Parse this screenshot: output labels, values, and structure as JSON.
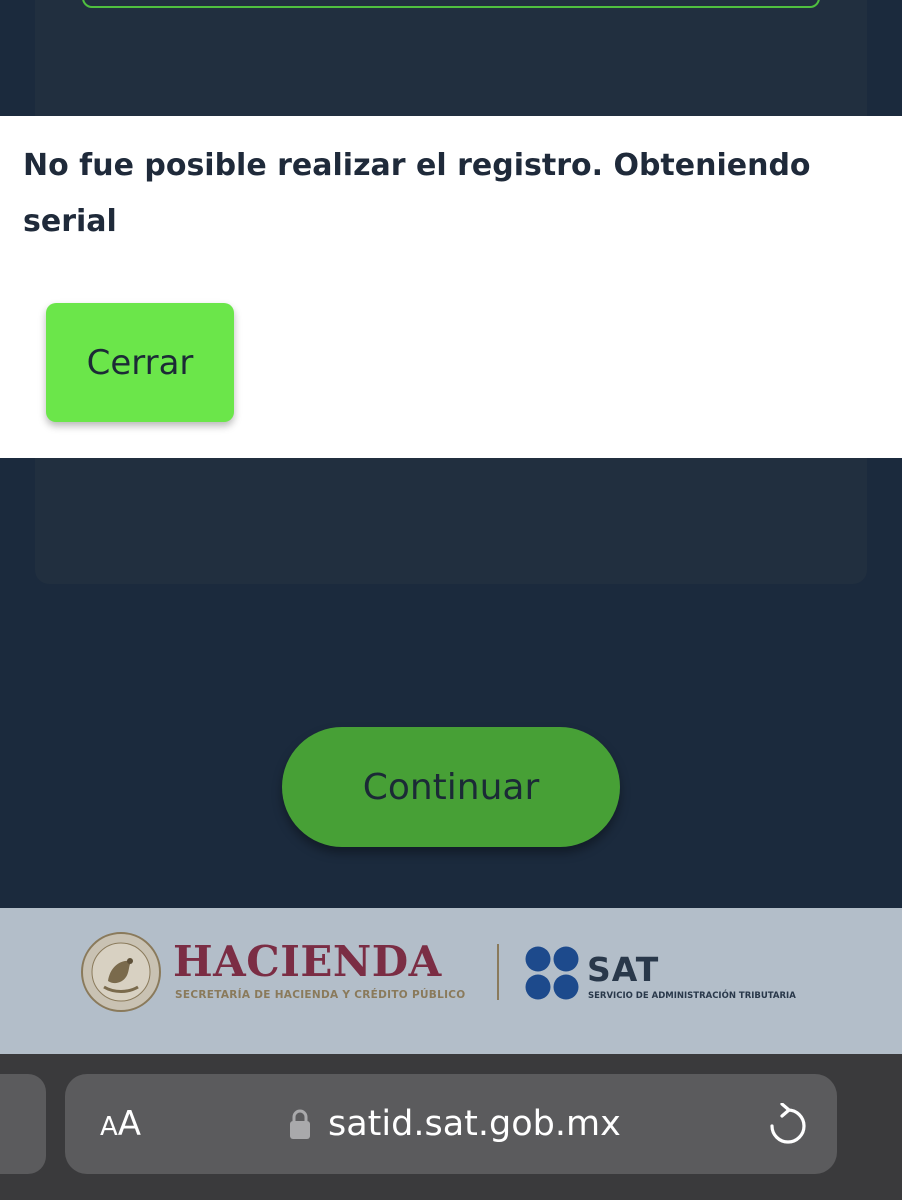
{
  "modal": {
    "message": "No fue posible realizar el registro. Obteniendo serial",
    "close_label": "Cerrar"
  },
  "main": {
    "continue_label": "Continuar"
  },
  "footer": {
    "hacienda_title": "HACIENDA",
    "hacienda_subtitle": "SECRETARÍA DE HACIENDA Y CRÉDITO PÚBLICO",
    "sat_title": "SAT",
    "sat_subtitle": "SERVICIO DE ADMINISTRACIÓN TRIBUTARIA"
  },
  "browser": {
    "text_size_small": "A",
    "text_size_big": "A",
    "url": "satid.sat.gob.mx"
  },
  "colors": {
    "background": "#1b2a3d",
    "modal_bg": "#ffffff",
    "close_button": "#6be64a",
    "continue_button": "#47a036",
    "hacienda_maroon": "#7b2d44",
    "sat_blue": "#1d4a8c",
    "browser_bar": "#3a3a3c"
  },
  "icons": {
    "seal": "mexican-coat-of-arms-seal-icon",
    "sat_logo": "sat-four-dots-icon",
    "lock": "lock-icon",
    "reload": "reload-icon"
  }
}
